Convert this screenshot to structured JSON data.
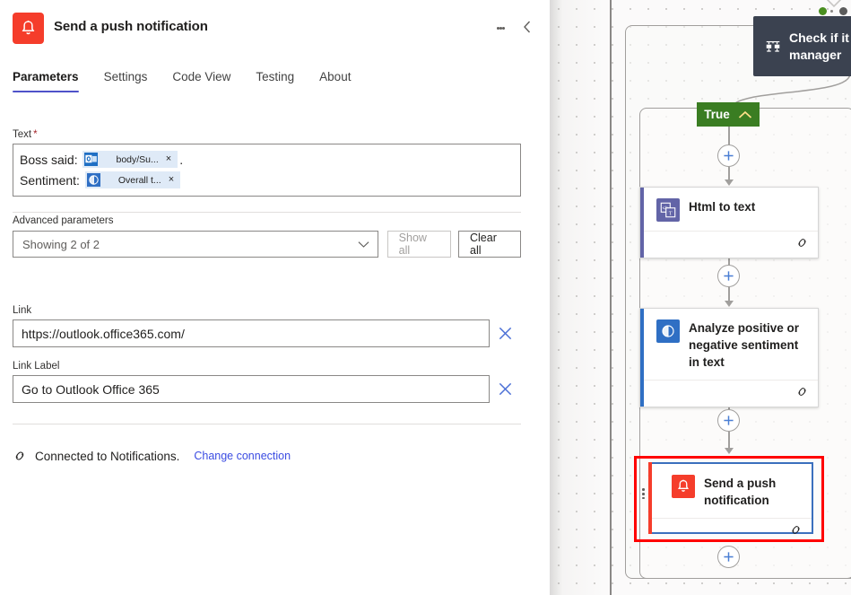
{
  "panel": {
    "title": "Send a push notification",
    "icon": "bell-icon",
    "more_menu": "more-options",
    "collapse": "collapse-panel",
    "tabs": [
      {
        "label": "Parameters",
        "active": true
      },
      {
        "label": "Settings",
        "active": false
      },
      {
        "label": "Code View",
        "active": false
      },
      {
        "label": "Testing",
        "active": false
      },
      {
        "label": "About",
        "active": false
      }
    ],
    "text_field": {
      "label": "Text",
      "required_marker": "*",
      "line1": {
        "prefix": "Boss said: ",
        "token_label": "body/Su...",
        "token_icon": "outlook-icon",
        "suffix": "."
      },
      "line2": {
        "prefix": "Sentiment: ",
        "token_label": "Overall t...",
        "token_icon": "text-analytics-icon"
      },
      "token_remove": "×"
    },
    "advanced": {
      "label": "Advanced parameters",
      "select_value": "Showing 2 of 2",
      "show_all_label": "Show all",
      "clear_all_label": "Clear all"
    },
    "link_field": {
      "label": "Link",
      "value": "https://outlook.office365.com/",
      "placeholder": "Link"
    },
    "link_label_field": {
      "label": "Link Label",
      "value": "Go to Outlook Office 365",
      "placeholder": "Link Label"
    },
    "connection": {
      "status_text": "Connected to Notifications.",
      "change_label": "Change connection"
    }
  },
  "canvas": {
    "condition_tooltip": {
      "line1": "Check if it",
      "line2": "manager",
      "icon": "condition-icon"
    },
    "status_dots": {
      "running_color": "#4a8f20",
      "stopped_color": "#5c5c5c"
    },
    "branch_badge": {
      "label": "True",
      "color": "#3a7d22"
    },
    "cards": [
      {
        "title": "Html to text",
        "icon": "html-to-text-icon",
        "accent_color": "#6264a7",
        "icon_bg": "#6264a7",
        "selected": false
      },
      {
        "title": "Analyze positive or negative sentiment in text",
        "icon": "text-analytics-icon",
        "accent_color": "#2f6fc4",
        "icon_bg": "#2f6fc4",
        "selected": false
      },
      {
        "title": "Send a push notification",
        "icon": "bell-icon",
        "accent_color": "#f53d2b",
        "icon_bg": "#f53d2b",
        "selected": true
      }
    ],
    "add_step_label": "+"
  },
  "colors": {
    "accent_blue": "#4f52c9",
    "link_blue": "#3b4ce2",
    "annotation_red": "#ff0000",
    "selection_blue": "#3b6fbd",
    "brand_red": "#f53d2b",
    "green": "#3a7d22"
  }
}
